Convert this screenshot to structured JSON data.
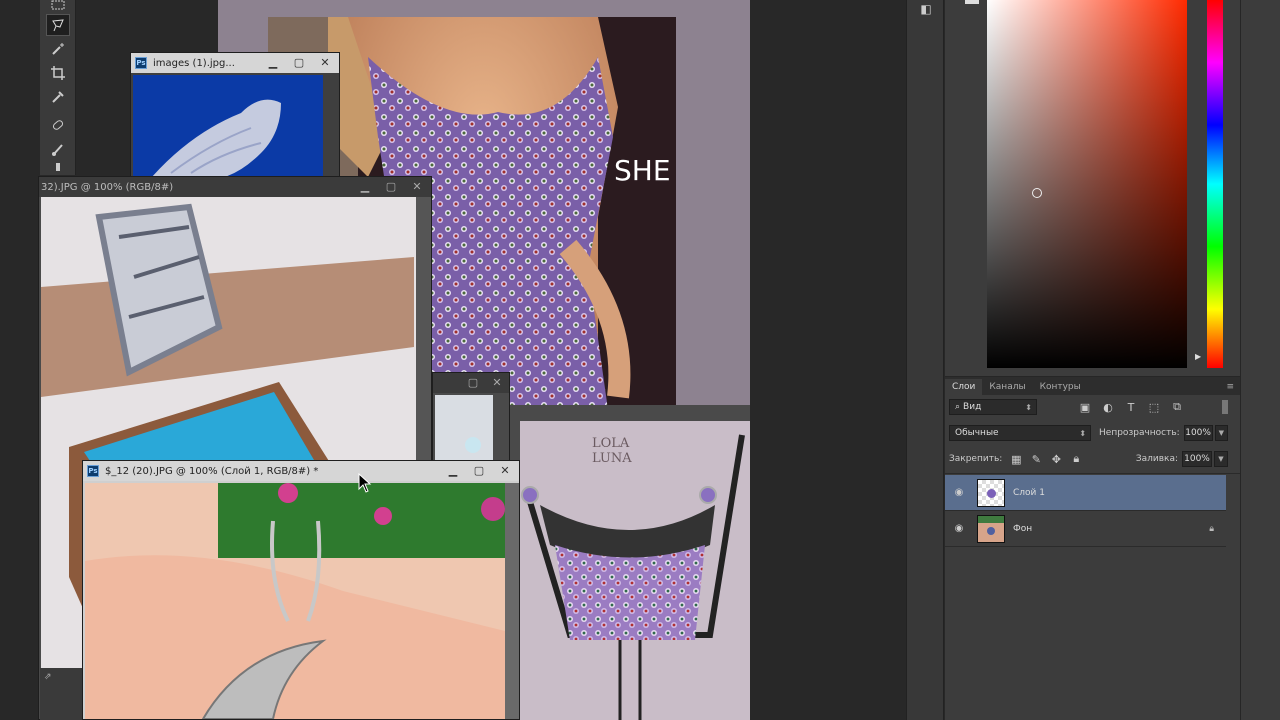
{
  "windows": [
    {
      "id": "lace",
      "title": "images (1).jpg..."
    },
    {
      "id": "ring",
      "title": "32).JPG @ 100% (RGB/8#)"
    },
    {
      "id": "pendant",
      "title": "$_12 (20).JPG @ 100% (Слой 1, RGB/8#) *"
    },
    {
      "id": "small",
      "title": ""
    }
  ],
  "artwork": {
    "dress_brand": "SHE",
    "lingerie_brand_line1": "LOLA",
    "lingerie_brand_line2": "LUNA"
  },
  "layers_panel": {
    "tabs": [
      "Слои",
      "Каналы",
      "Контуры"
    ],
    "active_tab": "Слои",
    "filter_label": "Вид",
    "blend_mode": "Обычные",
    "opacity_label": "Непрозрачность:",
    "opacity_value": "100%",
    "lock_label": "Закрепить:",
    "fill_label": "Заливка:",
    "fill_value": "100%",
    "layers": [
      {
        "name": "Слой 1",
        "selected": true,
        "locked": false
      },
      {
        "name": "Фон",
        "selected": false,
        "locked": true
      }
    ]
  },
  "colors": {
    "picker_hue": "#ff2a00",
    "selection": "#5a6e8e",
    "panel_bg": "#3c3c3c"
  },
  "icons": [
    "marquee-icon",
    "lasso-icon",
    "magic-wand-icon",
    "crop-icon",
    "eyedropper-icon",
    "healing-brush-icon",
    "brush-icon",
    "eye-icon",
    "lock-icon",
    "ps-icon"
  ]
}
